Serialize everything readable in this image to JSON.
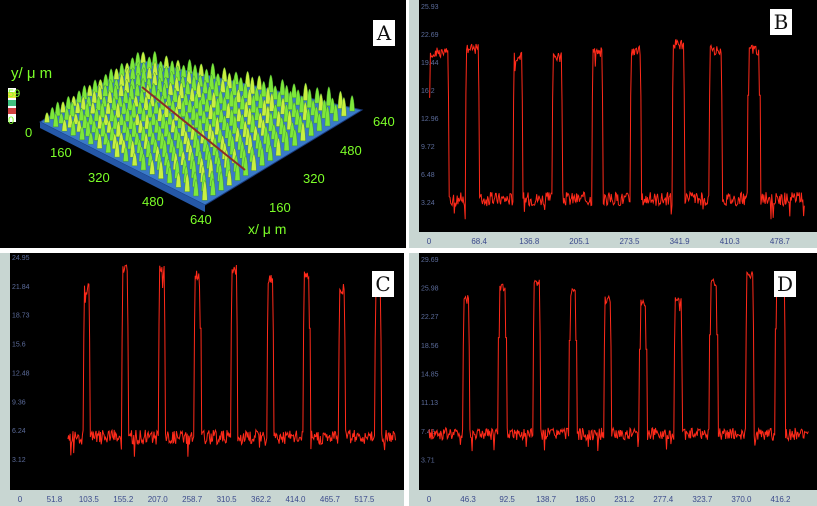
{
  "panels": {
    "A": {
      "letter": "A",
      "y_axis_label": "y/ μ m",
      "x_axis_label": "x/ μ m",
      "z_ticks": [
        "59",
        "0"
      ],
      "y_ticks": [
        "0",
        "160",
        "320",
        "480",
        "640"
      ],
      "x_ticks": [
        "640",
        "480",
        "320",
        "160"
      ],
      "mark": "↵"
    },
    "B": {
      "letter": "B"
    },
    "C": {
      "letter": "C"
    },
    "D": {
      "letter": "D"
    }
  },
  "chart_data": [
    {
      "panel": "B",
      "type": "line",
      "x_ticks": [
        "0",
        "68.4",
        "136.8",
        "205.1",
        "273.5",
        "341.9",
        "410.3",
        "478.7"
      ],
      "y_ticks": [
        "25.93",
        "22.69",
        "19.44",
        "16.2",
        "12.96",
        "9.72",
        "6.48",
        "3.24"
      ],
      "xlim": [
        0,
        513
      ],
      "ylim": [
        0,
        25.93
      ],
      "series": [
        {
          "peaks": [
            [
              0,
              27,
              20.5
            ],
            [
              50,
              69,
              21.0
            ],
            [
              115,
              128,
              20.0
            ],
            [
              168,
              182,
              20.0
            ],
            [
              222,
              237,
              20.6
            ],
            [
              275,
              290,
              20.7
            ],
            [
              332,
              349,
              21.5
            ],
            [
              382,
              400,
              20.8
            ],
            [
              435,
              452,
              20.8
            ]
          ],
          "baseline": 3.6,
          "color": "#ff2a1a"
        }
      ]
    },
    {
      "panel": "C",
      "type": "line",
      "x_ticks": [
        "0",
        "51.8",
        "103.5",
        "155.2",
        "207.0",
        "258.7",
        "310.5",
        "362.2",
        "414.0",
        "465.7",
        "517.5"
      ],
      "y_ticks": [
        "24.95",
        "21.84",
        "18.73",
        "15.6",
        "12.48",
        "9.36",
        "6.24",
        "3.12"
      ],
      "xlim": [
        0,
        565
      ],
      "ylim": [
        0,
        24.95
      ],
      "series": [
        {
          "start": 72,
          "peaks": [
            [
              95,
              105,
              21.5
            ],
            [
              153,
              163,
              23.5
            ],
            [
              208,
              218,
              23.5
            ],
            [
              262,
              272,
              23.0
            ],
            [
              317,
              327,
              23.5
            ],
            [
              371,
              381,
              22.5
            ],
            [
              426,
              436,
              23.0
            ],
            [
              479,
              489,
              21.5
            ],
            [
              533,
              543,
              21.5
            ]
          ],
          "baseline": 5.5,
          "color": "#ff2a1a"
        }
      ]
    },
    {
      "panel": "D",
      "type": "line",
      "x_ticks": [
        "0",
        "46.3",
        "92.5",
        "138.7",
        "185.0",
        "231.2",
        "277.4",
        "323.7",
        "370.0",
        "416.2"
      ],
      "y_ticks": [
        "29.69",
        "25.98",
        "22.27",
        "18.56",
        "14.85",
        "11.13",
        "7.42",
        "3.71"
      ],
      "xlim": [
        0,
        450
      ],
      "ylim": [
        0,
        29.69
      ],
      "series": [
        {
          "peaks": [
            [
              40,
              48,
              24.5
            ],
            [
              82,
              92,
              26.0
            ],
            [
              123,
              132,
              26.5
            ],
            [
              166,
              175,
              25.5
            ],
            [
              207,
              216,
              24.5
            ],
            [
              249,
              258,
              24.0
            ],
            [
              290,
              300,
              24.5
            ],
            [
              332,
              342,
              26.5
            ],
            [
              375,
              385,
              27.5
            ],
            [
              410,
              422,
              27.5
            ]
          ],
          "baseline": 7.0,
          "color": "#ff2a1a"
        }
      ]
    }
  ]
}
